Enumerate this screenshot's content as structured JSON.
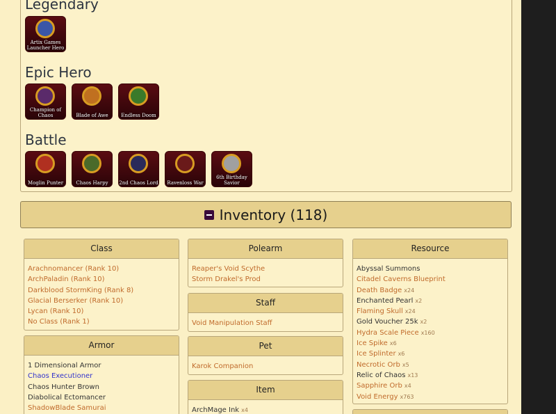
{
  "badges": {
    "categories": [
      {
        "title": "Legendary",
        "items": [
          "Artix Games Launcher Hero"
        ]
      },
      {
        "title": "Epic Hero",
        "items": [
          "Champion of Chaos",
          "Blade of Awe",
          "Endless Doom"
        ]
      },
      {
        "title": "Battle",
        "items": [
          "Moglin Punter",
          "Chaos Harpy",
          "2nd Chaos Lord",
          "Ravenloss War",
          "6th Birthday Savior"
        ]
      }
    ]
  },
  "inventory": {
    "title": "Inventory (118)"
  },
  "cards": {
    "class": {
      "title": "Class",
      "items": [
        {
          "text": "Arachnomancer (Rank 10)",
          "style": "link",
          "qty": ""
        },
        {
          "text": "ArchPaladin (Rank 10)",
          "style": "link",
          "qty": ""
        },
        {
          "text": "Darkblood StormKing (Rank 8)",
          "style": "link",
          "qty": ""
        },
        {
          "text": "Glacial Berserker (Rank 10)",
          "style": "link",
          "qty": ""
        },
        {
          "text": "Lycan (Rank 10)",
          "style": "link",
          "qty": ""
        },
        {
          "text": "No Class (Rank 1)",
          "style": "link",
          "qty": ""
        }
      ]
    },
    "armor": {
      "title": "Armor",
      "items": [
        {
          "text": "1 Dimensional Armor",
          "style": "plain",
          "qty": ""
        },
        {
          "text": "Chaos Executioner",
          "style": "blue",
          "qty": ""
        },
        {
          "text": "Chaos Hunter Brown",
          "style": "plain",
          "qty": ""
        },
        {
          "text": "Diabolical Ectomancer",
          "style": "plain",
          "qty": ""
        },
        {
          "text": "ShadowBlade Samurai",
          "style": "link",
          "qty": ""
        }
      ]
    },
    "polearm": {
      "title": "Polearm",
      "items": [
        {
          "text": "Reaper's Void Scythe",
          "style": "link",
          "qty": ""
        },
        {
          "text": "Storm Drakel's Prod",
          "style": "link",
          "qty": ""
        }
      ]
    },
    "staff": {
      "title": "Staff",
      "items": [
        {
          "text": "Void Manipulation Staff",
          "style": "link",
          "qty": ""
        }
      ]
    },
    "pet": {
      "title": "Pet",
      "items": [
        {
          "text": "Karok Companion",
          "style": "link",
          "qty": ""
        }
      ]
    },
    "item": {
      "title": "Item",
      "items": [
        {
          "text": "ArchMage Ink",
          "style": "plain",
          "qty": "x4"
        }
      ]
    },
    "resource": {
      "title": "Resource",
      "items": [
        {
          "text": "Abyssal Summons",
          "style": "plain",
          "qty": ""
        },
        {
          "text": "Citadel Caverns Blueprint",
          "style": "link",
          "qty": ""
        },
        {
          "text": "Death Badge",
          "style": "link",
          "qty": "x24"
        },
        {
          "text": "Enchanted Pearl",
          "style": "plain",
          "qty": "x2"
        },
        {
          "text": "Flaming Skull",
          "style": "link",
          "qty": "x24"
        },
        {
          "text": "Gold Voucher 25k",
          "style": "plain",
          "qty": "x2"
        },
        {
          "text": "Hydra Scale Piece",
          "style": "link",
          "qty": "x160"
        },
        {
          "text": "Ice Spike",
          "style": "link",
          "qty": "x6"
        },
        {
          "text": "Ice Splinter",
          "style": "link",
          "qty": "x6"
        },
        {
          "text": "Necrotic Orb",
          "style": "link",
          "qty": "x5"
        },
        {
          "text": "Relic of Chaos",
          "style": "plain",
          "qty": "x13"
        },
        {
          "text": "Sapphire Orb",
          "style": "link",
          "qty": "x4"
        },
        {
          "text": "Void Energy",
          "style": "link",
          "qty": "x763"
        }
      ]
    }
  },
  "colors": {
    "panel_bg": "#fcf2c9",
    "header_bg": "#e6d08d",
    "link": "#c06a2b",
    "blue_link": "#3333cc",
    "badge_bg": "#5a0c12"
  },
  "badge_medal_colors": [
    "#3a56a8",
    "#5a2a6a",
    "#c07020",
    "#3a7a2a",
    "#b03020",
    "#4a6a2a",
    "#2a2a5a",
    "#6a1a1a",
    "#a0a0a0"
  ]
}
